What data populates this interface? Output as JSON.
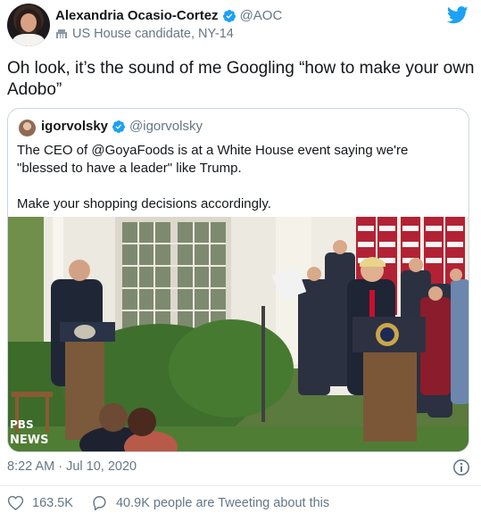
{
  "author": {
    "display_name": "Alexandria Ocasio-Cortez",
    "handle": "@AOC",
    "label": "US House candidate, NY-14"
  },
  "tweet": {
    "text": "Oh look, it’s the sound of me Googling “how to make your own Adobo”"
  },
  "quoted": {
    "display_name": "igorvolsky",
    "handle": "@igorvolsky",
    "text": "The CEO of @GoyaFoods is at a White House event saying we're \"blessed to have a leader\" like Trump.\n\nMake your shopping decisions accordingly.",
    "media_watermark": "PBS NEWS"
  },
  "meta": {
    "timestamp": "8:22 AM · Jul 10, 2020",
    "likes": "163.5K",
    "conversation": "40.9K people are Tweeting about this"
  },
  "colors": {
    "twitter_blue": "#1da1f2",
    "secondary_text": "#657786",
    "border": "#ccd6dd"
  }
}
